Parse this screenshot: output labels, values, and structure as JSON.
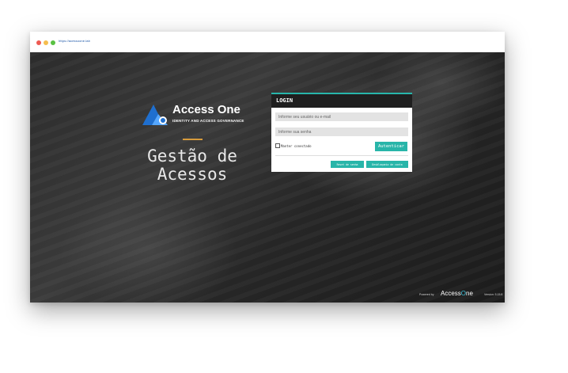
{
  "browser": {
    "url": "https://acessoone.lab"
  },
  "brand": {
    "name": "Access One",
    "tagline": "IDENTITY AND ACCESS GOVERNANCE",
    "colors": {
      "accent": "#28b5a9",
      "logo_dark": "#1f6fcf",
      "logo_light": "#55a7ff",
      "divider": "#d79b3c"
    }
  },
  "hero": {
    "line1": "Gestão de",
    "line2": "Acessos"
  },
  "login": {
    "title": "LOGIN",
    "user_placeholder": "Informe seu usuário ou e-mail",
    "password_placeholder": "Informe sua senha",
    "remember_label": "Manter conectado",
    "submit_label": "Autenticar",
    "reset_label": "Reset de senha",
    "unlock_label": "Desbloqueio de conta"
  },
  "footer": {
    "powered_by": "Powered by",
    "brand_prefix": "Access",
    "brand_o": "O",
    "brand_suffix": "ne",
    "version": "Version: 5.15.8"
  },
  "icons": {
    "logo": "access-one-mountain-logo",
    "window_controls": [
      "close-dot",
      "minimize-dot",
      "maximize-dot"
    ]
  }
}
